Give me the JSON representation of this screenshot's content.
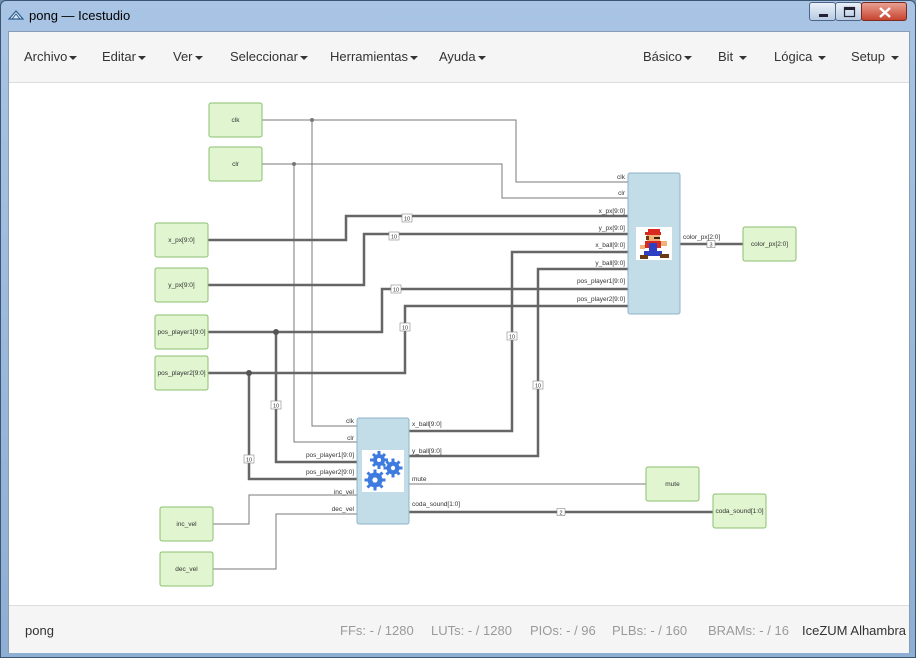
{
  "window": {
    "title": "pong — Icestudio"
  },
  "menu": {
    "left": [
      "Archivo",
      "Editar",
      "Ver",
      "Seleccionar",
      "Herramientas",
      "Ayuda"
    ],
    "right": [
      "Básico",
      "Bit",
      "Lógica",
      "Setup"
    ]
  },
  "canvas": {
    "inputs": {
      "clk": "clk",
      "clr": "clr",
      "x_px": "x_px[9:0]",
      "y_px": "y_px[9:0]",
      "pos_player1": "pos_player1[9:0]",
      "pos_player2": "pos_player2[9:0]",
      "inc_vel": "inc_vel",
      "dec_vel": "dec_vel"
    },
    "outputs": {
      "color_px": "color_px[2:0]",
      "mute": "mute",
      "coda_sound": "coda_sound[1:0]"
    },
    "render_block": {
      "in_ports": [
        "clk",
        "clr",
        "x_px[9:0]",
        "y_px[9:0]",
        "x_ball[9:0]",
        "y_ball[9:0]",
        "pos_player1[9:0]",
        "pos_player2[9:0]"
      ],
      "out_ports": [
        "color_px[2:0]"
      ]
    },
    "logic_block": {
      "in_ports": [
        "clk",
        "clr",
        "pos_player1[9:0]",
        "pos_player2[9:0]",
        "inc_vel",
        "dec_vel"
      ],
      "out_ports": [
        "x_ball[9:0]",
        "y_ball[9:0]",
        "mute",
        "coda_sound[1:0]"
      ]
    },
    "bus_widths": {
      "ten": "10",
      "three": "3",
      "two": "2"
    }
  },
  "status": {
    "project": "pong",
    "resources": [
      {
        "name": "FFs:",
        "value": "- / 1280"
      },
      {
        "name": "LUTs:",
        "value": "- / 1280"
      },
      {
        "name": "PIOs:",
        "value": "- / 96"
      },
      {
        "name": "PLBs:",
        "value": "- / 160"
      },
      {
        "name": "BRAMs:",
        "value": "- / 16"
      }
    ],
    "board": "IceZUM Alhambra"
  },
  "colors": {
    "io_fill": "#e0f5d0",
    "io_border": "#8bbf6e",
    "block_fill": "#c2dce8",
    "block_border": "#8fb4c8",
    "wire": "#777777",
    "bus": "#666666"
  }
}
